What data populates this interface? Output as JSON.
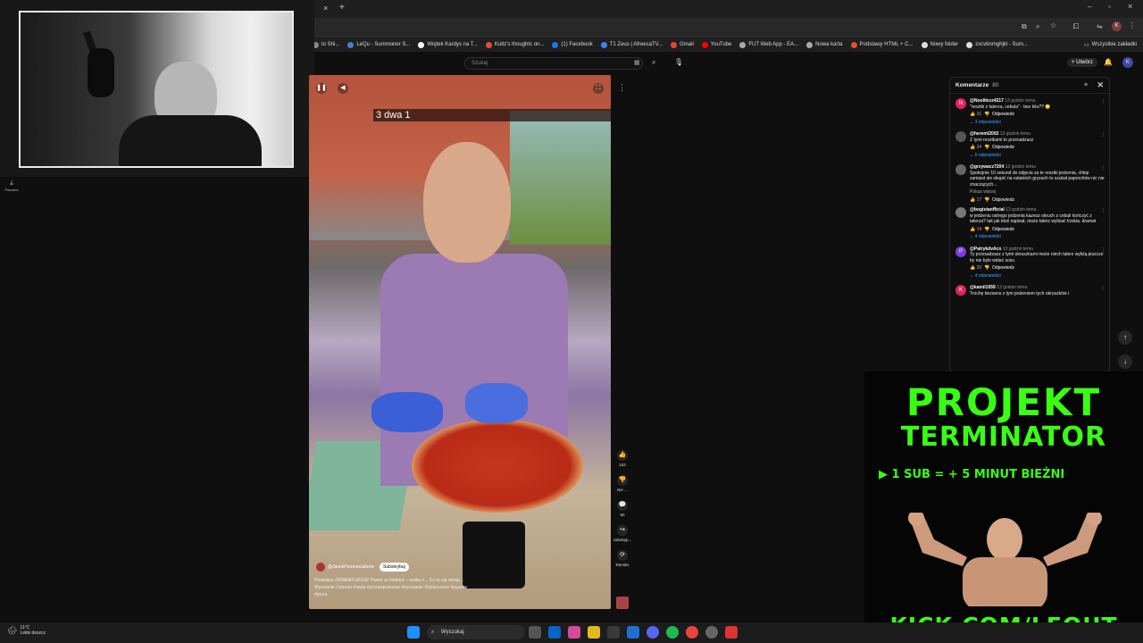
{
  "browser": {
    "bookmarks": [
      {
        "label": "to Shi...",
        "color": "#888888"
      },
      {
        "label": "LeQu - Summoner S...",
        "color": "#4a7bd6"
      },
      {
        "label": "Wojtek Kardys na T...",
        "color": "#ffffff"
      },
      {
        "label": "Kultz's thoughts on...",
        "color": "#e74c3c"
      },
      {
        "label": "(1) Facebook",
        "color": "#1877f2"
      },
      {
        "label": "T1 Zeus | AfreecaTV...",
        "color": "#3b82f6"
      },
      {
        "label": "Gmail",
        "color": "#ea4335"
      },
      {
        "label": "YouTube",
        "color": "#ff0000"
      },
      {
        "label": "FUT Web App - EA...",
        "color": "#aaaaaa"
      },
      {
        "label": "Nowa karta",
        "color": "#aaaaaa"
      },
      {
        "label": "Podstawy HTML + C...",
        "color": "#e44d26"
      },
      {
        "label": "Nowy folder",
        "color": "#dddddd"
      },
      {
        "label": "zxcvbnmghjkl - Sum...",
        "color": "#dddddd"
      }
    ],
    "other_bookmarks": "Wszystkie zakładki",
    "profile_letter": "K"
  },
  "youtube": {
    "search_placeholder": "Szukaj",
    "create_label": "Utwórz",
    "avatar_letter": "K"
  },
  "video": {
    "caption": "3 dwa 1",
    "channel": "@JacekPizzeriaJabenz",
    "subscribe": "Subskrybuj",
    "description": "Podwójna DRAMATURGIA! Pawel vs Norbert – walka o... Co tu się dzieje... Wyzwanie Ostrości Pawła #pizzawjednante #wyzwanie #bylopyszne #pyszne #pizza",
    "actions": [
      {
        "icon": "like-icon",
        "glyph": "👍",
        "label": "152"
      },
      {
        "icon": "dislike-icon",
        "glyph": "👎",
        "label": "Nie ..."
      },
      {
        "icon": "comment-icon",
        "glyph": "💬",
        "label": "80"
      },
      {
        "icon": "share-icon",
        "glyph": "↪",
        "label": "Udostęp..."
      },
      {
        "icon": "remix-icon",
        "glyph": "⟳",
        "label": "Remiks"
      }
    ]
  },
  "comments": {
    "title": "Komentarze",
    "count": "80",
    "items": [
      {
        "avatar": "N",
        "color": "#e91e63",
        "user": "@Noolitezz4217",
        "time": "13 godzin temu",
        "text": "\"resztki z talerza, cebula\" - bez kitu?? 😳",
        "likes": "31",
        "reply": "Odpowiedz",
        "replies": "3 odpowiedzi"
      },
      {
        "avatar": "",
        "color": "#555555",
        "user": "@hereml2002",
        "time": "13 godzin temu",
        "text": "Z tymi resztkami to przesadzasz",
        "likes": "34",
        "reply": "Odpowiedz",
        "replies": "6 odpowiedzi"
      },
      {
        "avatar": "",
        "color": "#666666",
        "user": "@grzywacz7204",
        "time": "13 godzin temu",
        "text": "Spokojnie 10 sekund do odjęcia za te resztki jedzenia, chłop zamiast sie skupić na ostatnich gryzach to szukał paprochów nic nie znaczących...",
        "more": "Pokaż więcej",
        "likes": "17",
        "reply": "Odpowiedz",
        "replies": ""
      },
      {
        "avatar": "",
        "color": "#777777",
        "user": "@bogistanfficial",
        "time": "13 godzin temu",
        "text": "w jedzeniu ostrego jedzenia kazesz okruch z cebuli kończyć z talerza? tak jak ktoś napisał, może talerz wylizać trzeba. dramat",
        "likes": "14",
        "reply": "Odpowiedz",
        "replies": "4 odpowiedzi"
      },
      {
        "avatar": "P",
        "color": "#7b3fd6",
        "user": "@PatrykdvAco",
        "time": "13 godzin temu",
        "text": "Ty przesadzasz z tymi okruszkami może niech talerz wyliżą jeszcze by nie było widać sosu",
        "likes": "20",
        "reply": "Odpowiedz",
        "replies": "4 odpowiedzi"
      },
      {
        "avatar": "K",
        "color": "#d6285a",
        "user": "@kamil1059",
        "time": "13 godzin temu",
        "text": "Trochę bezsens z tym jedzeniem tych okruszków i",
        "likes": "",
        "reply": "",
        "replies": ""
      }
    ]
  },
  "promo": {
    "line1": "PROJEKT",
    "line2": "TERMINATOR",
    "sub": "▶ 1 SUB = + 5 MINUT BIEŻNI",
    "url": "KICK.COM/LEQUT",
    "accent": "#39ff14"
  },
  "taskbar": {
    "temp": "11°C",
    "weather": "Lekki deszcz",
    "search": "Wyszukaj",
    "downloads": "Pobrane"
  }
}
